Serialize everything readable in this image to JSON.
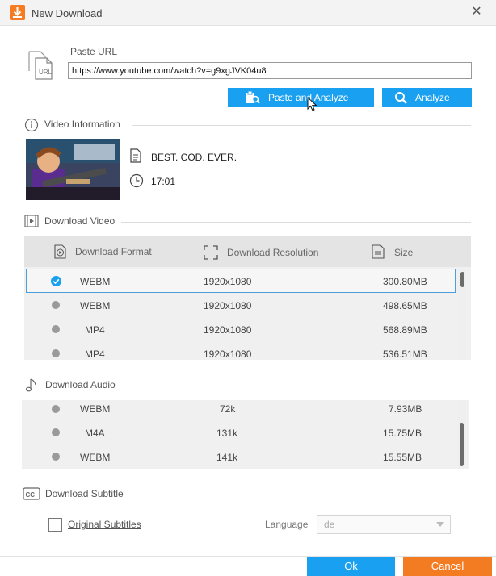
{
  "window": {
    "title": "New Download",
    "close_glyph": "✕"
  },
  "url_section": {
    "icon_text": "URL",
    "label": "Paste URL",
    "value": "https://www.youtube.com/watch?v=g9xgJVK04u8",
    "paste_analyze_label": "Paste and Analyze",
    "analyze_label": "Analyze"
  },
  "video_info": {
    "header": "Video Information",
    "title": "BEST. COD. EVER.",
    "duration": "17:01"
  },
  "download_video": {
    "header": "Download Video",
    "columns": {
      "format": "Download Format",
      "resolution": "Download Resolution",
      "size": "Size"
    },
    "rows": [
      {
        "format": "WEBM",
        "resolution": "1920x1080",
        "size": "300.80MB",
        "selected": true
      },
      {
        "format": "WEBM",
        "resolution": "1920x1080",
        "size": "498.65MB",
        "selected": false
      },
      {
        "format": "MP4",
        "resolution": "1920x1080",
        "size": "568.89MB",
        "selected": false
      },
      {
        "format": "MP4",
        "resolution": "1920x1080",
        "size": "536.51MB",
        "selected": false
      }
    ]
  },
  "download_audio": {
    "header": "Download Audio",
    "rows": [
      {
        "format": "WEBM",
        "bitrate": "72k",
        "size": "7.93MB"
      },
      {
        "format": "M4A",
        "bitrate": "131k",
        "size": "15.75MB"
      },
      {
        "format": "WEBM",
        "bitrate": "141k",
        "size": "15.55MB"
      }
    ]
  },
  "download_subtitle": {
    "header": "Download Subtitle",
    "original_label": "Original Subtitles",
    "language_label": "Language",
    "language_value": "de"
  },
  "footer": {
    "ok_label": "Ok",
    "cancel_label": "Cancel"
  },
  "colors": {
    "accent_blue": "#1aa0f0",
    "accent_orange": "#f37b22"
  }
}
